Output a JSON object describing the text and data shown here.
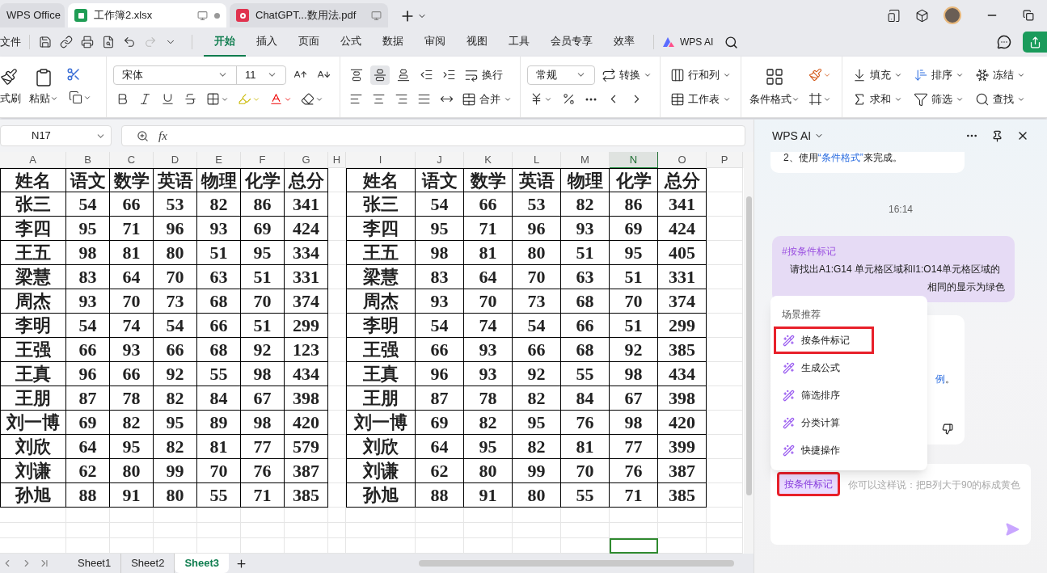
{
  "tabs": [
    {
      "label": "WPS Office",
      "kind": "home",
      "selected": false
    },
    {
      "label": "工作簿2.xlsx",
      "kind": "sheet",
      "selected": true
    },
    {
      "label": "ChatGPT...数用法.pdf",
      "kind": "pdf",
      "selected": false
    }
  ],
  "menu": {
    "file": "文件",
    "quick_access": [
      {
        "kind": "save",
        "disabled": false
      },
      {
        "kind": "link",
        "disabled": false
      },
      {
        "kind": "print",
        "disabled": false
      },
      {
        "kind": "preview",
        "disabled": false
      },
      {
        "kind": "undo",
        "disabled": false
      },
      {
        "kind": "redo",
        "disabled": true
      },
      {
        "kind": "more",
        "disabled": false
      }
    ],
    "tabs": [
      {
        "label": "开始",
        "selected": true
      },
      {
        "label": "插入",
        "selected": false
      },
      {
        "label": "页面",
        "selected": false
      },
      {
        "label": "公式",
        "selected": false
      },
      {
        "label": "数据",
        "selected": false
      },
      {
        "label": "审阅",
        "selected": false
      },
      {
        "label": "视图",
        "selected": false
      },
      {
        "label": "工具",
        "selected": false
      },
      {
        "label": "会员专享",
        "selected": false
      },
      {
        "label": "效率",
        "selected": false
      }
    ],
    "ai": "WPS AI"
  },
  "ribbon": {
    "format_painter": "式刷",
    "paste": "粘贴",
    "font_name": "宋体",
    "font_size": "11",
    "vertical_align": [
      {
        "selected": false
      },
      {
        "selected": true
      },
      {
        "selected": false
      }
    ],
    "wrap": "换行",
    "merge": "合并",
    "number_format": "常规",
    "convert": "转换",
    "rows_cols": "行和列",
    "worksheet": "工作表",
    "conditional": "条件格式",
    "fill": "填充",
    "sort": "排序",
    "freeze": "冻结",
    "sum": "求和",
    "filter": "筛选",
    "find": "查找"
  },
  "formula_bar": {
    "name_box": "N17",
    "fx": "fx"
  },
  "columns": [
    {
      "label": "A",
      "selected": false
    },
    {
      "label": "B",
      "selected": false
    },
    {
      "label": "C",
      "selected": false
    },
    {
      "label": "D",
      "selected": false
    },
    {
      "label": "E",
      "selected": false
    },
    {
      "label": "F",
      "selected": false
    },
    {
      "label": "G",
      "selected": false
    },
    {
      "label": "H",
      "selected": false
    },
    {
      "label": "I",
      "selected": false
    },
    {
      "label": "J",
      "selected": false
    },
    {
      "label": "K",
      "selected": false
    },
    {
      "label": "L",
      "selected": false
    },
    {
      "label": "M",
      "selected": false
    },
    {
      "label": "N",
      "selected": true
    },
    {
      "label": "O",
      "selected": false
    },
    {
      "label": "P",
      "selected": false
    }
  ],
  "table_left": {
    "header": [
      "姓名",
      "语文",
      "数学",
      "英语",
      "物理",
      "化学",
      "总分"
    ],
    "rows": [
      [
        "张三",
        "54",
        "66",
        "53",
        "82",
        "86",
        "341"
      ],
      [
        "李四",
        "95",
        "71",
        "96",
        "93",
        "69",
        "424"
      ],
      [
        "王五",
        "98",
        "81",
        "80",
        "51",
        "95",
        "334"
      ],
      [
        "梁慧",
        "83",
        "64",
        "70",
        "63",
        "51",
        "331"
      ],
      [
        "周杰",
        "93",
        "70",
        "73",
        "68",
        "70",
        "374"
      ],
      [
        "李明",
        "54",
        "74",
        "54",
        "66",
        "51",
        "299"
      ],
      [
        "王强",
        "66",
        "93",
        "66",
        "68",
        "92",
        "123"
      ],
      [
        "王真",
        "96",
        "66",
        "92",
        "55",
        "98",
        "434"
      ],
      [
        "王朋",
        "87",
        "78",
        "82",
        "84",
        "67",
        "398"
      ],
      [
        "刘一博",
        "69",
        "82",
        "95",
        "89",
        "98",
        "420"
      ],
      [
        "刘欣",
        "64",
        "95",
        "82",
        "81",
        "77",
        "579"
      ],
      [
        "刘谦",
        "62",
        "80",
        "99",
        "70",
        "76",
        "387"
      ],
      [
        "孙旭",
        "88",
        "91",
        "80",
        "55",
        "71",
        "385"
      ]
    ]
  },
  "table_right": {
    "header": [
      "姓名",
      "语文",
      "数学",
      "英语",
      "物理",
      "化学",
      "总分"
    ],
    "rows": [
      [
        "张三",
        "54",
        "66",
        "53",
        "82",
        "86",
        "341"
      ],
      [
        "李四",
        "95",
        "71",
        "96",
        "93",
        "69",
        "424"
      ],
      [
        "王五",
        "98",
        "81",
        "80",
        "51",
        "95",
        "405"
      ],
      [
        "梁慧",
        "83",
        "64",
        "70",
        "63",
        "51",
        "331"
      ],
      [
        "周杰",
        "93",
        "70",
        "73",
        "68",
        "70",
        "374"
      ],
      [
        "李明",
        "54",
        "74",
        "54",
        "66",
        "51",
        "299"
      ],
      [
        "王强",
        "66",
        "93",
        "66",
        "68",
        "92",
        "385"
      ],
      [
        "王真",
        "96",
        "93",
        "92",
        "55",
        "98",
        "434"
      ],
      [
        "王朋",
        "87",
        "78",
        "82",
        "84",
        "67",
        "398"
      ],
      [
        "刘一博",
        "69",
        "82",
        "95",
        "76",
        "98",
        "420"
      ],
      [
        "刘欣",
        "64",
        "95",
        "82",
        "81",
        "77",
        "399"
      ],
      [
        "刘谦",
        "62",
        "80",
        "99",
        "70",
        "76",
        "387"
      ],
      [
        "孙旭",
        "88",
        "91",
        "80",
        "55",
        "71",
        "385"
      ]
    ]
  },
  "sheets": [
    {
      "label": "Sheet1",
      "selected": false
    },
    {
      "label": "Sheet2",
      "selected": false
    },
    {
      "label": "Sheet3",
      "selected": true
    }
  ],
  "ai_panel": {
    "title": "WPS AI",
    "reply": {
      "before": "2、使用",
      "link": "“条件格式”",
      "after": "来完成。"
    },
    "time": "16:14",
    "user_message": {
      "tag": "#按条件标记",
      "lines": [
        "请找出A1:G14 单元格区域和I1:O14单元格区域的",
        "相同的显示为绿色"
      ]
    },
    "card": {
      "link": "例",
      "after": "。"
    },
    "popup": {
      "title": "场景推荐",
      "items": [
        {
          "label": "按条件标记",
          "selected": true
        },
        {
          "label": "生成公式",
          "selected": false
        },
        {
          "label": "筛选排序",
          "selected": false
        },
        {
          "label": "分类计算",
          "selected": false
        },
        {
          "label": "快捷操作",
          "selected": false
        }
      ]
    },
    "input": {
      "chip": "按条件标记",
      "chip_highlighted": true,
      "placeholder": "你可以这样说：把B列大于90的标成黄色"
    }
  }
}
